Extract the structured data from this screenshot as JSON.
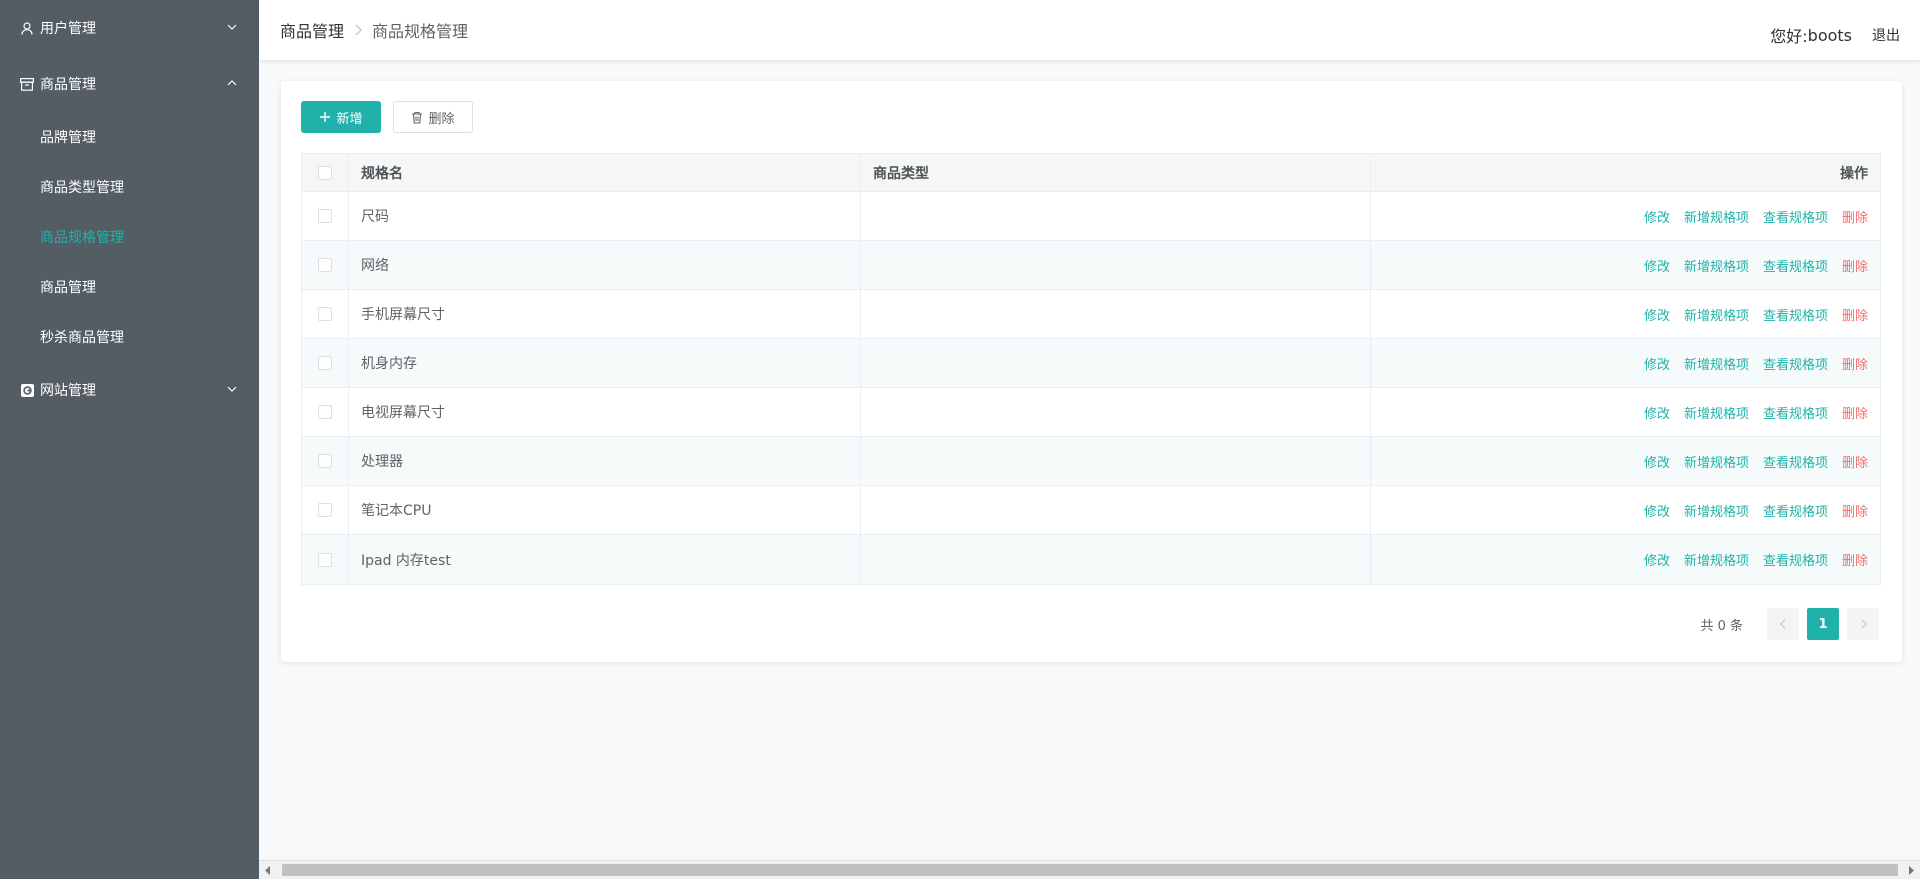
{
  "sidebar": {
    "menus": [
      {
        "label": "用户管理",
        "icon": "user-icon",
        "expanded": false
      },
      {
        "label": "商品管理",
        "icon": "box-icon",
        "expanded": true
      },
      {
        "label": "网站管理",
        "icon": "web-icon",
        "expanded": false
      }
    ],
    "submenu": [
      {
        "label": "品牌管理"
      },
      {
        "label": "商品类型管理"
      },
      {
        "label": "商品规格管理",
        "active": true
      },
      {
        "label": "商品管理"
      },
      {
        "label": "秒杀商品管理"
      }
    ]
  },
  "header": {
    "breadcrumb": [
      "商品管理",
      "商品规格管理"
    ],
    "greeting": "您好:",
    "username": "boots",
    "logout": "退出"
  },
  "toolbar": {
    "add_label": "新增",
    "delete_label": "删除"
  },
  "table": {
    "columns": [
      "规格名",
      "商品类型",
      "操作"
    ],
    "rows": [
      {
        "name": "尺码",
        "type": ""
      },
      {
        "name": "网络",
        "type": ""
      },
      {
        "name": "手机屏幕尺寸",
        "type": ""
      },
      {
        "name": "机身内存",
        "type": ""
      },
      {
        "name": "电视屏幕尺寸",
        "type": ""
      },
      {
        "name": "处理器",
        "type": ""
      },
      {
        "name": "笔记本CPU",
        "type": ""
      },
      {
        "name": "Ipad 内存test",
        "type": ""
      }
    ],
    "row_actions": [
      "修改",
      "新增规格项",
      "查看规格项",
      "删除"
    ]
  },
  "pagination": {
    "total_text": "共 0 条",
    "current_page": "1"
  },
  "colors": {
    "accent": "#20b2aa",
    "danger": "#f56c6c",
    "sidebar_bg": "#545c64"
  }
}
